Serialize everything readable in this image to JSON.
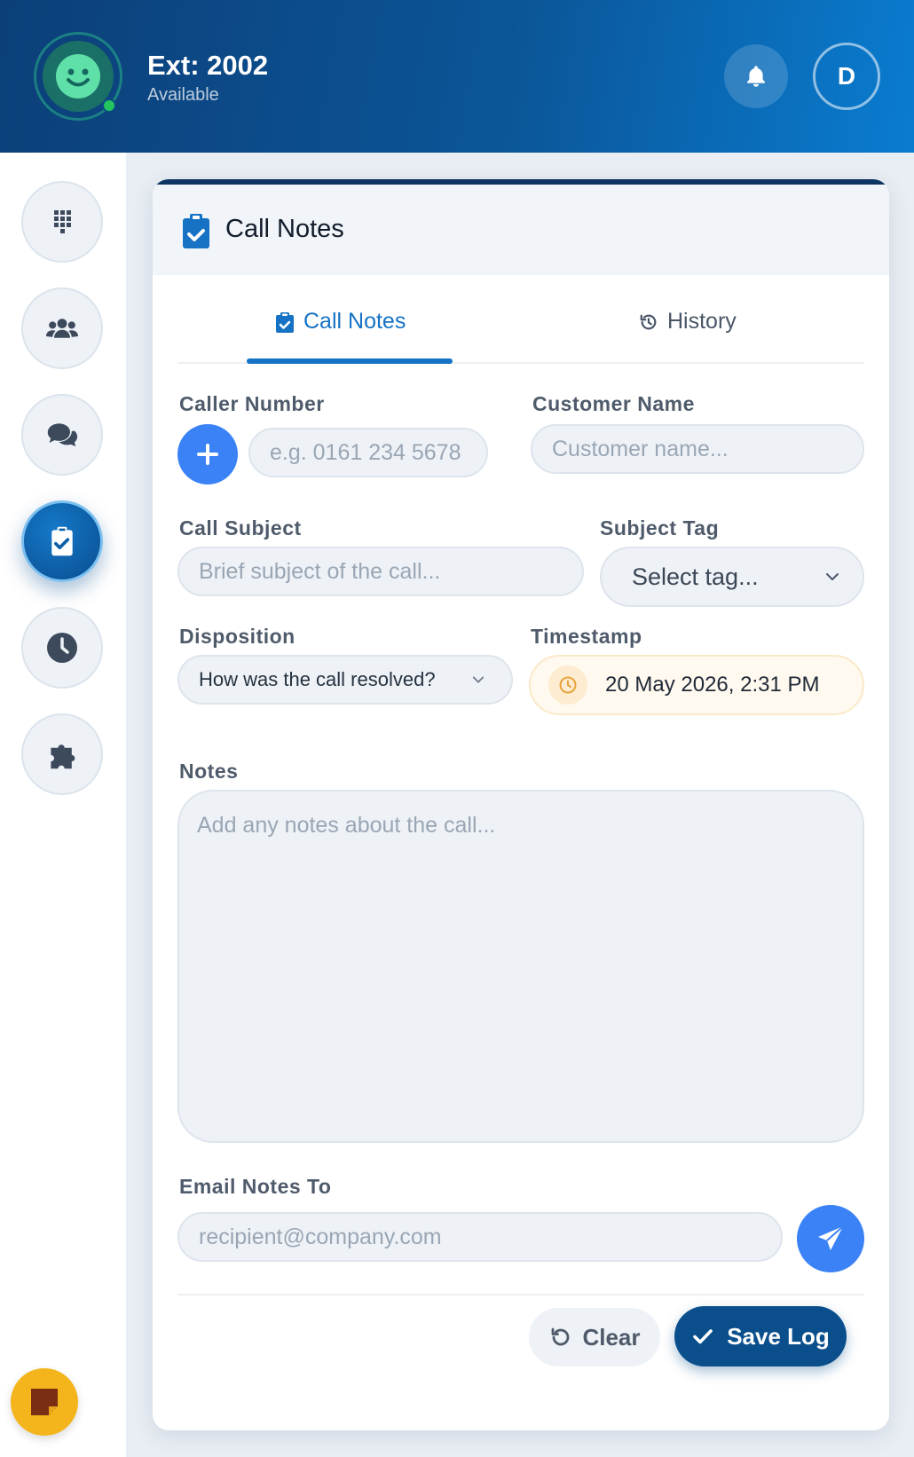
{
  "header": {
    "extension": "Ext: 2002",
    "status": "Available",
    "avatar_initial": "D"
  },
  "sidebar": {
    "items": [
      {
        "icon": "dialpad-icon"
      },
      {
        "icon": "contacts-icon"
      },
      {
        "icon": "chat-icon"
      },
      {
        "icon": "call-notes-icon",
        "active": true
      },
      {
        "icon": "history-clock-icon"
      },
      {
        "icon": "integrations-icon"
      }
    ],
    "sticky_icon": "sticky-note-icon"
  },
  "card": {
    "title": "Call Notes",
    "tabs": [
      {
        "label": "Call Notes",
        "active": true
      },
      {
        "label": "History",
        "active": false
      }
    ]
  },
  "form": {
    "caller_number": {
      "label": "Caller Number",
      "placeholder": "e.g. 0161 234 5678",
      "value": ""
    },
    "customer_name": {
      "label": "Customer Name",
      "placeholder": "Customer name...",
      "value": ""
    },
    "call_subject": {
      "label": "Call Subject",
      "placeholder": "Brief subject of the call...",
      "value": ""
    },
    "subject_tag": {
      "label": "Subject Tag",
      "selected": "Select tag..."
    },
    "disposition": {
      "label": "Disposition",
      "selected": "How was the call resolved?"
    },
    "timestamp": {
      "label": "Timestamp",
      "value": "20 May 2026, 2:31 PM"
    },
    "notes": {
      "label": "Notes",
      "placeholder": "Add any notes about the call..."
    },
    "email": {
      "label": "Email Notes To",
      "placeholder": "recipient@company.com"
    }
  },
  "actions": {
    "clear_label": "Clear",
    "save_label": "Save Log"
  },
  "colors": {
    "brand_dark": "#0a4f8c",
    "accent": "#1572c4",
    "button_blue": "#3b82f6",
    "status_green": "#22c55e",
    "sticky_yellow": "#f4b51c"
  }
}
